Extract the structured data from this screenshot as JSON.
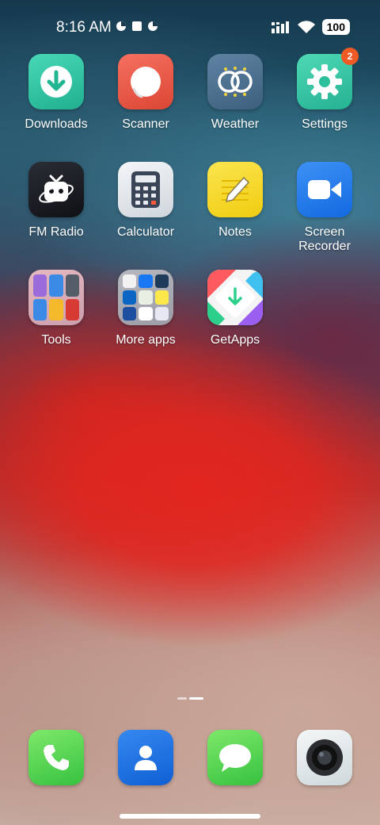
{
  "status_bar": {
    "time": "8:16 AM",
    "battery": "100"
  },
  "apps": [
    {
      "label": "Downloads",
      "icon": "download-icon",
      "color": "#33c7a4"
    },
    {
      "label": "Scanner",
      "icon": "scanner-icon",
      "color": "#ee5a45"
    },
    {
      "label": "Weather",
      "icon": "weather-icon",
      "color": "#4d6f8e"
    },
    {
      "label": "Settings",
      "icon": "gear-icon",
      "color": "#34c9a6",
      "badge": "2"
    },
    {
      "label": "FM Radio",
      "icon": "radio-icon",
      "color": "#1b1e24"
    },
    {
      "label": "Calculator",
      "icon": "calculator-icon",
      "color": "#e8ecef"
    },
    {
      "label": "Notes",
      "icon": "notes-icon",
      "color": "#f7da2a"
    },
    {
      "label": "Screen Recorder",
      "icon": "video-camera-icon",
      "color": "#1e78ec"
    },
    {
      "label": "Tools",
      "icon": "folder-icon",
      "color": "#d8a7b1"
    },
    {
      "label": "More apps",
      "icon": "folder-icon",
      "color": "#a9aab3"
    },
    {
      "label": "GetApps",
      "icon": "getapps-icon",
      "color": "#f4f4f4"
    }
  ],
  "dock": [
    {
      "name": "phone",
      "icon": "phone-icon",
      "color": "#4cd964"
    },
    {
      "name": "contacts",
      "icon": "contacts-icon",
      "color": "#1a6fe6"
    },
    {
      "name": "messages",
      "icon": "message-icon",
      "color": "#4cd964"
    },
    {
      "name": "camera",
      "icon": "camera-icon",
      "color": "#e9eef0"
    }
  ]
}
